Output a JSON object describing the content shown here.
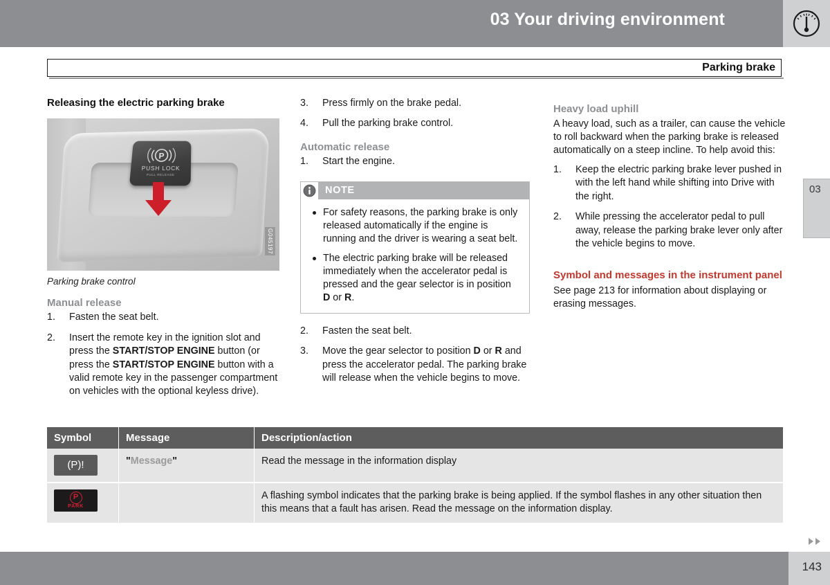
{
  "header": {
    "title": "03 Your driving environment",
    "icon": "gauge-icon",
    "bg_color": "#8c8e91"
  },
  "chapter_tab": {
    "label": "03"
  },
  "title_bar": {
    "text": "Parking brake"
  },
  "left_column": {
    "heading": "Releasing the electric parking brake",
    "figure": {
      "caption": "Parking brake control",
      "image_id": "G045197",
      "button_symbol": "P",
      "button_text_primary": "PUSH LOCK",
      "button_text_secondary": "PULL RELEASE",
      "arrow_color": "#cc1f2a"
    },
    "manual_release": {
      "heading": "Manual release",
      "items": [
        {
          "num": "1.",
          "text": "Fasten the seat belt."
        },
        {
          "num": "2.",
          "text_parts": [
            {
              "t": "Insert the remote key in the ignition slot and press the ",
              "b": false
            },
            {
              "t": "START/STOP ENGINE",
              "b": true
            },
            {
              "t": " button (or press the ",
              "b": false
            },
            {
              "t": "START/STOP ENGINE",
              "b": true
            },
            {
              "t": " button with a valid remote key in the passenger compartment on vehicles with the optional keyless drive).",
              "b": false
            }
          ]
        }
      ]
    }
  },
  "mid_column": {
    "manual_release_cont": [
      {
        "num": "3.",
        "text": "Press firmly on the brake pedal."
      },
      {
        "num": "4.",
        "text": "Pull the parking brake control."
      }
    ],
    "automatic_release": {
      "heading": "Automatic release",
      "items_before_note": [
        {
          "num": "1.",
          "text": "Start the engine."
        }
      ],
      "items_after_note": [
        {
          "num": "2.",
          "text": "Fasten the seat belt."
        },
        {
          "num": "3.",
          "text_parts": [
            {
              "t": "Move the gear selector to position ",
              "b": false
            },
            {
              "t": "D",
              "b": true
            },
            {
              "t": " or ",
              "b": false
            },
            {
              "t": "R",
              "b": true
            },
            {
              "t": " and press the accelerator pedal. The parking brake will release when the vehicle begins to move.",
              "b": false
            }
          ]
        }
      ]
    },
    "note_box": {
      "title": "NOTE",
      "icon": "info-icon",
      "bullets": [
        {
          "text_parts": [
            {
              "t": "For safety reasons, the parking brake is only released automatically if the engine is running and the driver is wearing a seat belt.",
              "b": false
            }
          ]
        },
        {
          "text_parts": [
            {
              "t": "The electric parking brake will be released immediately when the accelerator pedal is pressed and the gear selector is in position ",
              "b": false
            },
            {
              "t": "D",
              "b": true
            },
            {
              "t": " or ",
              "b": false
            },
            {
              "t": "R",
              "b": true
            },
            {
              "t": ".",
              "b": false
            }
          ]
        }
      ]
    }
  },
  "right_column": {
    "heavy_load": {
      "heading": "Heavy load uphill",
      "paragraph": "A heavy load, such as a trailer, can cause the vehicle to roll backward when the parking brake is released automatically on a steep incline. To help avoid this:",
      "items": [
        {
          "num": "1.",
          "text": "Keep the electric parking brake lever pushed in with the left hand while shifting into Drive with the right."
        },
        {
          "num": "2.",
          "text": "While pressing the accelerator pedal to pull away, release the parking brake lever only after the vehicle begins to move."
        }
      ]
    },
    "symbol_messages": {
      "heading": "Symbol and messages in the instrument panel",
      "heading_color": "#c0392e",
      "paragraph": "See page 213 for information about displaying or erasing messages."
    }
  },
  "table": {
    "headers": [
      "Symbol",
      "Message",
      "Description/action"
    ],
    "rows": [
      {
        "symbol_type": "p-bang",
        "symbol_text": "(P)!",
        "message_open_quote": "\"",
        "message_word": "Message",
        "message_close_quote": "\"",
        "description": "Read the message in the information display"
      },
      {
        "symbol_type": "park",
        "symbol_text": "P",
        "symbol_sublabel": "PARK",
        "message_open_quote": "",
        "message_word": "",
        "message_close_quote": "",
        "description": "A flashing symbol indicates that the parking brake is being applied. If the symbol flashes in any other situation then this means that a fault has arisen. Read the message on the information display."
      }
    ]
  },
  "footer": {
    "page_number": "143",
    "arrows": "▶▶"
  }
}
